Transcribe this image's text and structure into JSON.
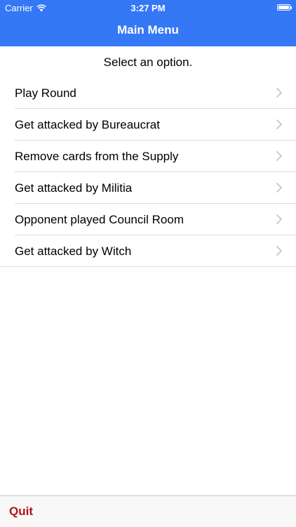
{
  "status_bar": {
    "carrier": "Carrier",
    "time": "3:27 PM"
  },
  "nav": {
    "title": "Main Menu"
  },
  "prompt": "Select an option.",
  "menu": {
    "items": [
      {
        "label": "Play Round"
      },
      {
        "label": "Get attacked by Bureaucrat"
      },
      {
        "label": "Remove cards from the Supply"
      },
      {
        "label": "Get attacked by Militia"
      },
      {
        "label": "Opponent played Council Room"
      },
      {
        "label": "Get attacked by Witch"
      }
    ]
  },
  "toolbar": {
    "quit_label": "Quit"
  },
  "colors": {
    "nav_background": "#3478f6",
    "quit_text": "#b3141c",
    "chevron": "#c7c7cc"
  },
  "icons": {
    "wifi": "wifi-icon",
    "battery": "battery-icon",
    "chevron": "chevron-right-icon"
  }
}
